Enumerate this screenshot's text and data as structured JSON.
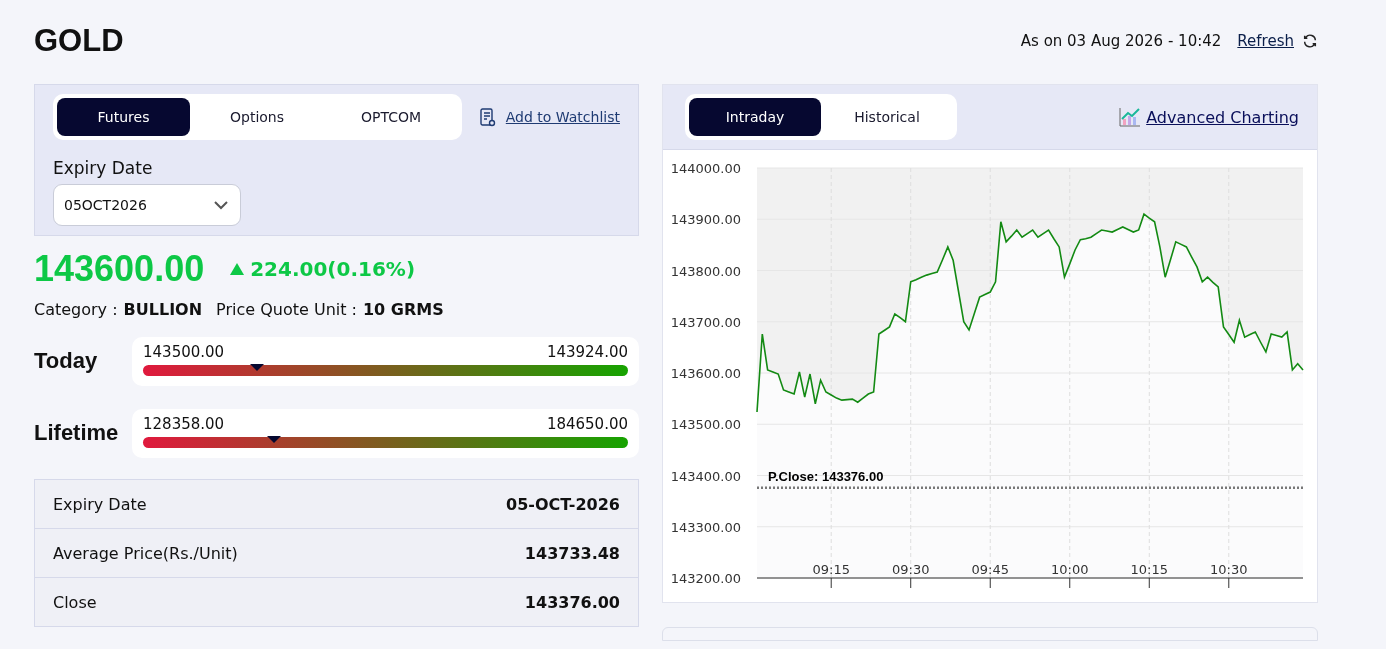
{
  "header": {
    "title": "GOLD",
    "as_on": "As on 03 Aug 2026 - 10:42",
    "refresh": "Refresh"
  },
  "contract_panel": {
    "tabs": [
      {
        "label": "Futures",
        "selected": true
      },
      {
        "label": "Options",
        "selected": false
      },
      {
        "label": "OPTCOM",
        "selected": false
      }
    ],
    "watchlist": "Add to Watchlist",
    "expiry_label": "Expiry Date",
    "expiry_value": "05OCT2026"
  },
  "quote": {
    "price": "143600.00",
    "change": "224.00(0.16%)",
    "up": true,
    "category_label": "Category :",
    "category": "BULLION",
    "unit_label": "Price Quote Unit :",
    "unit": "10 GRMS"
  },
  "ranges": [
    {
      "label": "Today",
      "low": "143500.00",
      "high": "143924.00",
      "level": 0.236
    },
    {
      "label": "Lifetime",
      "low": "128358.00",
      "high": "184650.00",
      "level": 0.27
    }
  ],
  "stats": [
    {
      "label": "Expiry Date",
      "value": "05-OCT-2026"
    },
    {
      "label": "Average Price(Rs./Unit)",
      "value": "143733.48"
    },
    {
      "label": "Close",
      "value": "143376.00"
    }
  ],
  "chart_panel": {
    "tabs": [
      {
        "label": "Intraday",
        "selected": true
      },
      {
        "label": "Historical",
        "selected": false
      }
    ],
    "advanced": "Advanced Charting",
    "chart_data": {
      "type": "line",
      "categories": [
        null,
        null,
        null,
        null,
        null,
        null,
        null,
        null,
        null,
        null,
        null,
        null,
        null,
        null,
        "09:15",
        null,
        null,
        null,
        null,
        null,
        null,
        null,
        null,
        null,
        null,
        null,
        null,
        null,
        null,
        "09:30",
        null,
        null,
        null,
        null,
        null,
        null,
        null,
        null,
        null,
        null,
        null,
        null,
        null,
        null,
        "09:45",
        null,
        null,
        null,
        null,
        null,
        null,
        null,
        null,
        null,
        null,
        null,
        null,
        null,
        null,
        "10:00",
        null,
        null,
        null,
        null,
        null,
        null,
        null,
        null,
        null,
        null,
        null,
        null,
        null,
        null,
        "10:15",
        null,
        null,
        null,
        null,
        null,
        null,
        null,
        null,
        null,
        null,
        null,
        null,
        null,
        null,
        "10:30",
        null,
        null,
        null,
        null,
        null,
        null,
        null,
        null,
        null,
        null,
        null,
        null,
        null,
        null
      ],
      "series": [
        {
          "color": "#138a13",
          "values": [
            143524,
            143676,
            143606,
            143602,
            143598,
            143567,
            143563,
            143559,
            143602,
            143553,
            143598,
            143540,
            143586,
            143563,
            143557,
            143551,
            143547,
            143548,
            143549,
            143543,
            143551,
            143559,
            143563,
            143676,
            143683,
            143690,
            143715,
            143708,
            143700,
            143778,
            143782,
            143787,
            143791,
            143794,
            143797,
            143821,
            143846,
            143820,
            143760,
            143700,
            143684,
            143716,
            143748,
            143753,
            143758,
            143778,
            143895,
            143856,
            143867,
            143879,
            143865,
            143872,
            143879,
            143865,
            143872,
            143879,
            143862,
            143846,
            143787,
            143813,
            143840,
            143860,
            143862,
            143865,
            143872,
            143879,
            143877,
            143875,
            143880,
            143885,
            143880,
            143875,
            143879,
            143910,
            143902,
            143895,
            143846,
            143787,
            143821,
            143856,
            143851,
            143846,
            143826,
            143807,
            143778,
            143787,
            143777,
            143768,
            143690,
            143675,
            143660,
            143703,
            143670,
            143675,
            143680,
            143660,
            143641,
            143676,
            143673,
            143670,
            143680,
            143606,
            143618,
            143606
          ]
        }
      ],
      "ylim": [
        143200,
        144000
      ],
      "yticks": [
        {
          "value": 144000,
          "label": "144000.00"
        },
        {
          "value": 143900,
          "label": "143900.00"
        },
        {
          "value": 143800,
          "label": "143800.00"
        },
        {
          "value": 143700,
          "label": "143700.00"
        },
        {
          "value": 143600,
          "label": "143600.00"
        },
        {
          "value": 143500,
          "label": "143500.00"
        },
        {
          "value": 143400,
          "label": "143400.00"
        },
        {
          "value": 143300,
          "label": "143300.00"
        },
        {
          "value": 143200,
          "label": "143200.00"
        }
      ],
      "grid": true,
      "ref_lines": [
        {
          "axis": "y",
          "value": 143376,
          "label": "P.Close: 143376.00"
        }
      ]
    }
  }
}
